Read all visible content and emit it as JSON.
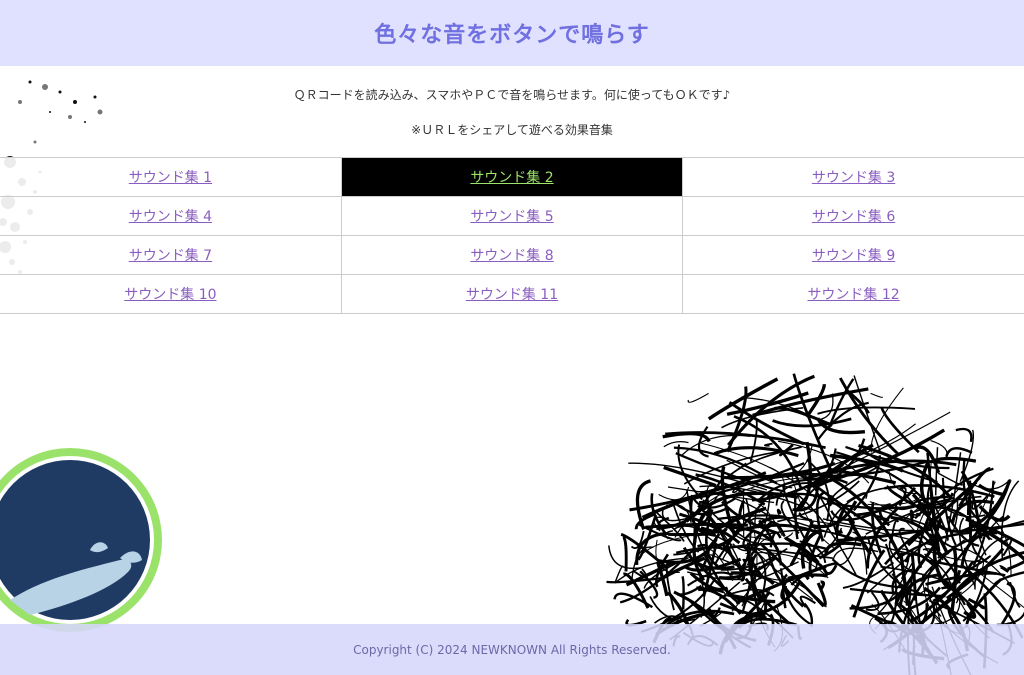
{
  "header": {
    "title": "色々な音をボタンで鳴らす"
  },
  "intro": {
    "line1": "ＱＲコードを読み込み、スマホやＰＣで音を鳴らせます。何に使ってもＯＫです♪",
    "line2": "※ＵＲＬをシェアして遊べる効果音集"
  },
  "sound_sets": {
    "active_index": 1,
    "rows": [
      [
        "サウンド集 1",
        "サウンド集 2",
        "サウンド集 3"
      ],
      [
        "サウンド集 4",
        "サウンド集 5",
        "サウンド集 6"
      ],
      [
        "サウンド集 7",
        "サウンド集 8",
        "サウンド集 9"
      ],
      [
        "サウンド集 10",
        "サウンド集 11",
        "サウンド集 12"
      ]
    ]
  },
  "footer": {
    "copyright": "Copyright (C) 2024 NEWKNOWN All Rights Reserved."
  },
  "colors": {
    "header_bg": "#e0e0ff",
    "title": "#7070e0",
    "link": "#8a5ec0",
    "active_bg": "#000000",
    "active_link": "#9be26a",
    "footer_bg": "#d6d6fa"
  },
  "icons": {
    "decorations": [
      "ink-splatter-icon",
      "scribble-art-icon",
      "badge-circle-icon"
    ]
  }
}
